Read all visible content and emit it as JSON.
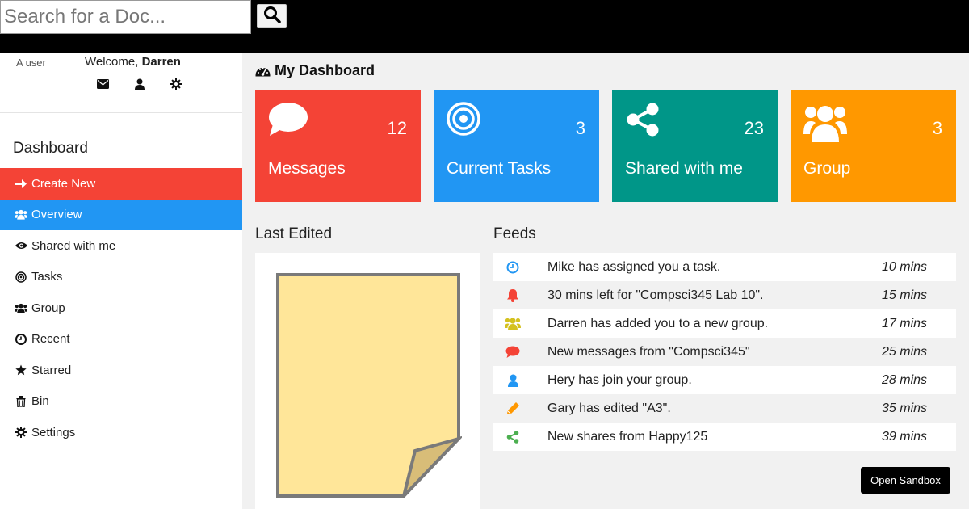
{
  "search": {
    "placeholder": "Search for a Doc..."
  },
  "profile": {
    "avatar_alt": "A user",
    "welcome_text": "Welcome, ",
    "user_name": "Darren"
  },
  "sidebar": {
    "heading": "Dashboard",
    "items": [
      {
        "label": "Create New",
        "icon": "arrow-right-icon"
      },
      {
        "label": "Overview",
        "icon": "users-icon"
      },
      {
        "label": "Shared with me",
        "icon": "eye-icon"
      },
      {
        "label": "Tasks",
        "icon": "target-icon"
      },
      {
        "label": "Group",
        "icon": "users-icon"
      },
      {
        "label": "Recent",
        "icon": "clock-icon"
      },
      {
        "label": "Starred",
        "icon": "star-icon"
      },
      {
        "label": "Bin",
        "icon": "trash-icon"
      },
      {
        "label": "Settings",
        "icon": "gear-icon"
      }
    ]
  },
  "main": {
    "title": "My Dashboard",
    "cards": [
      {
        "label": "Messages",
        "count": "12",
        "color": "#f44336",
        "icon": "comment-icon"
      },
      {
        "label": "Current Tasks",
        "count": "3",
        "color": "#2196f3",
        "icon": "target-icon"
      },
      {
        "label": "Shared with me",
        "count": "23",
        "color": "#009688",
        "icon": "share-icon"
      },
      {
        "label": "Group",
        "count": "3",
        "color": "#ff9800",
        "icon": "users-icon"
      }
    ],
    "last_edited_title": "Last Edited",
    "feeds_title": "Feeds",
    "feeds": [
      {
        "text": "Mike has assigned you a task.",
        "time": "10 mins",
        "icon": "clock-icon",
        "color": "#2196f3"
      },
      {
        "text": "30 mins left for \"Compsci345 Lab 10\".",
        "time": "15 mins",
        "icon": "bell-icon",
        "color": "#f44336"
      },
      {
        "text": "Darren has added you to a new group.",
        "time": "17 mins",
        "icon": "users-icon",
        "color": "#d4c11e"
      },
      {
        "text": "New messages from \"Compsci345\"",
        "time": "25 mins",
        "icon": "comment-icon",
        "color": "#f44336"
      },
      {
        "text": "Hery has join your group.",
        "time": "28 mins",
        "icon": "user-icon",
        "color": "#2196f3"
      },
      {
        "text": "Gary has edited \"A3\".",
        "time": "35 mins",
        "icon": "pencil-icon",
        "color": "#ff9800"
      },
      {
        "text": "New shares from Happy125",
        "time": "39 mins",
        "icon": "share-icon",
        "color": "#4caf50"
      }
    ],
    "sandbox_button": "Open Sandbox"
  }
}
